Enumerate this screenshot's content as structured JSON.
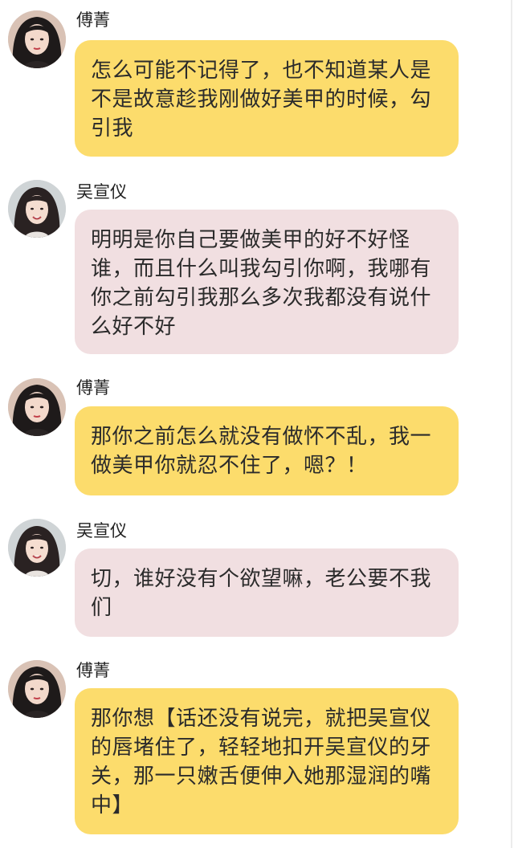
{
  "colors": {
    "bubble_fu": "#fcdc6c",
    "bubble_wu": "#f1dfe1",
    "text": "#2b2b2b"
  },
  "messages": [
    {
      "sender": "傅菁",
      "avatar": "avatar-fu-jing",
      "text": "怎么可能不记得了，也不知道某人是不是故意趁我刚做好美甲的时候，勾引我"
    },
    {
      "sender": "吴宣仪",
      "avatar": "avatar-wu-xuanyi",
      "text": "明明是你自己要做美甲的好不好怪谁，而且什么叫我勾引你啊，我哪有你之前勾引我那么多次我都没有说什么好不好"
    },
    {
      "sender": "傅菁",
      "avatar": "avatar-fu-jing",
      "text": "那你之前怎么就没有做怀不乱，我一做美甲你就忍不住了，嗯？！"
    },
    {
      "sender": "吴宣仪",
      "avatar": "avatar-wu-xuanyi",
      "text": "切，谁好没有个欲望嘛，老公要不我们"
    },
    {
      "sender": "傅菁",
      "avatar": "avatar-fu-jing",
      "text": "那你想【话还没有说完，就把吴宣仪的唇堵住了，轻轻地扣开吴宣仪的牙关，那一只嫩舌便伸入她那湿润的嘴中】"
    }
  ]
}
